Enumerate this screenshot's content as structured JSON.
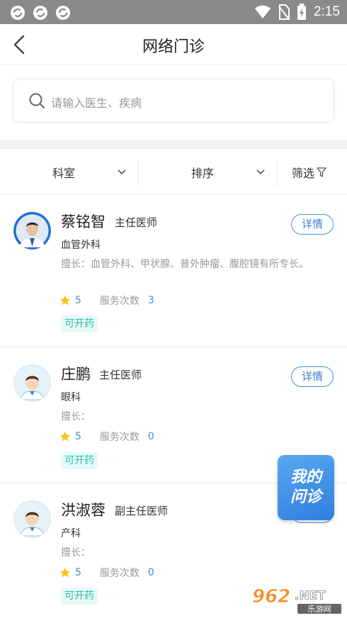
{
  "status_bar": {
    "time": "2:15"
  },
  "nav": {
    "title": "网络门诊"
  },
  "search": {
    "placeholder": "请输入医生、疾病"
  },
  "filters": {
    "department": "科室",
    "sort": "排序",
    "filter": "筛选"
  },
  "doctors": [
    {
      "name": "蔡铭智",
      "title": "主任医师",
      "department": "血管外科",
      "specialty": "擅长：血管外科、甲状腺、普外肿瘤、腹腔镜有所专长。",
      "rating": "5",
      "service_label": "服务次数",
      "service_count": "3",
      "tag": "可开药",
      "detail": "详情"
    },
    {
      "name": "庄鹏",
      "title": "主任医师",
      "department": "眼科",
      "specialty": "擅长：",
      "rating": "5",
      "service_label": "服务次数",
      "service_count": "0",
      "tag": "可开药",
      "detail": "详情"
    },
    {
      "name": "洪淑蓉",
      "title": "副主任医师",
      "department": "产科",
      "specialty": "擅长：",
      "rating": "5",
      "service_label": "服务次数",
      "service_count": "0",
      "tag": "可开药",
      "detail": "详情"
    }
  ],
  "float_button": {
    "line1": "我的",
    "line2": "问诊"
  },
  "watermark": {
    "brand": "962.NET",
    "sub": "乐游网"
  },
  "colors": {
    "accent": "#3a8fd9",
    "tag_text": "#1fc0b0",
    "tag_bg": "#e8faf8",
    "star": "#f5c518",
    "status_bar": "#8a8a8a"
  }
}
